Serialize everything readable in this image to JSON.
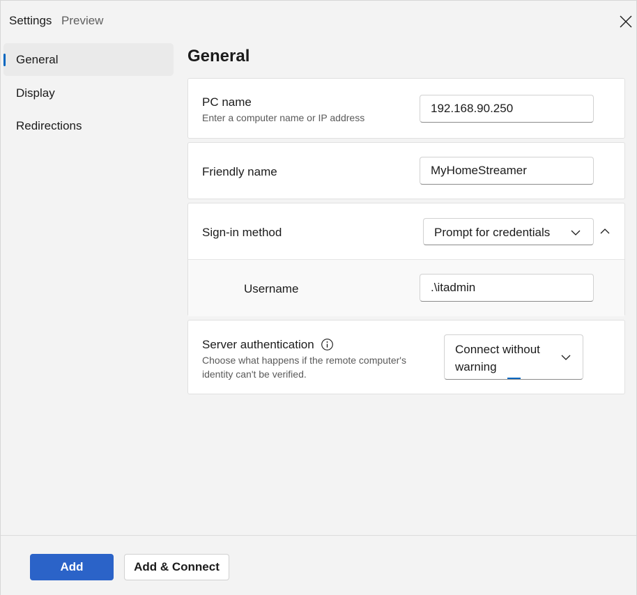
{
  "window": {
    "title": "Settings",
    "subtitle": "Preview"
  },
  "nav": {
    "items": [
      {
        "label": "General",
        "active": true
      },
      {
        "label": "Display",
        "active": false
      },
      {
        "label": "Redirections",
        "active": false
      }
    ]
  },
  "main": {
    "title": "General",
    "pc_name": {
      "label": "PC name",
      "description": "Enter a computer name or IP address",
      "value": "192.168.90.250"
    },
    "friendly_name": {
      "label": "Friendly name",
      "value": "MyHomeStreamer"
    },
    "sign_in": {
      "label": "Sign-in method",
      "selected": "Prompt for credentials",
      "expanded": true,
      "username_label": "Username",
      "username_value": ".\\itadmin"
    },
    "server_auth": {
      "label": "Server authentication",
      "description_line1": "Choose what happens if the remote computer's",
      "description_line2": "identity can't be verified.",
      "selected_line1": "Connect without",
      "selected_line2": "warning"
    }
  },
  "footer": {
    "add_label": "Add",
    "add_connect_label": "Add & Connect"
  },
  "colors": {
    "accent": "#2b63c8",
    "nav_indicator": "#0067c0",
    "background": "#f3f3f3",
    "card": "#ffffff"
  },
  "icons": {
    "close": "close-icon",
    "chevron_down": "chevron-down-icon",
    "chevron_up": "chevron-up-icon",
    "info": "info-icon"
  }
}
